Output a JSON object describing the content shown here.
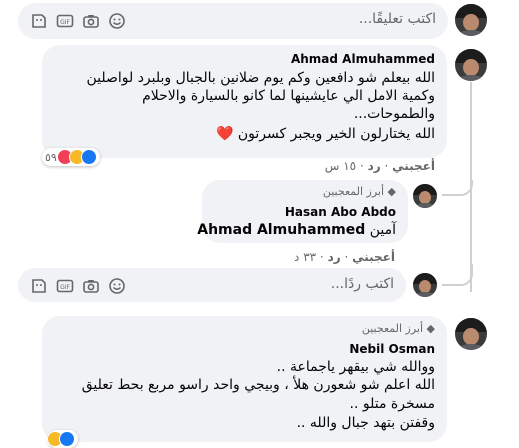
{
  "top_input": {
    "placeholder": "اكتب تعليقًا..."
  },
  "comment1": {
    "author": "Ahmad Almuhammed",
    "lines": [
      "الله بيعلم شو دافعين وكم يوم ضلانين بالجبال وبلبرد لواصلين",
      "وكمية الامل الي عايشينها لما كانو بالسيارة والاحلام",
      "والطموحات...",
      "الله يختارلون الخير ويجبر كسرتون ❤️"
    ],
    "meta": {
      "like": "أعجبني",
      "reply": "رد",
      "time": "١٥ س"
    },
    "reactions_count": "٥٩"
  },
  "reply1": {
    "badge": "أبرز المعجبين",
    "author": "Hasan Abo Abdo",
    "mention": "Ahmad Almuhammed",
    "text": "آمين",
    "meta": {
      "like": "أعجبني",
      "reply": "رد",
      "time": "٣٣ د"
    }
  },
  "reply_input": {
    "placeholder": "اكتب ردًا..."
  },
  "comment2": {
    "badge": "أبرز المعجبين",
    "author": "Nebil Osman",
    "lines": [
      "ووالله شي بيقهر ياجماعة ..",
      "الله اعلم شو شعورن هلأ ، وبيجي واحد راسو مربع بحط تعليق",
      "مسخرة متلو ..",
      "وقفتن بتهد جبال والله .."
    ]
  },
  "colors": {
    "bubble": "#f0f2f5",
    "meta": "#65676b",
    "like_blue": "#1877f2",
    "care_yellow": "#f7b928",
    "love_red": "#f33e58"
  }
}
